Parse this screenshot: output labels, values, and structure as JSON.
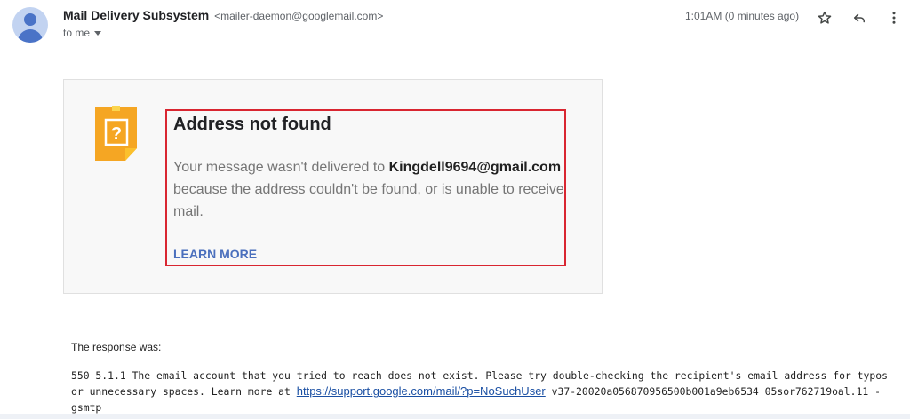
{
  "header": {
    "sender_name": "Mail Delivery Subsystem",
    "sender_email": "<mailer-daemon@googlemail.com>",
    "to_label": "to me",
    "timestamp": "1:01AM (0 minutes ago)",
    "icons": [
      "avatar",
      "star-icon",
      "reply-icon",
      "more-vert-icon",
      "chevron-down-icon"
    ]
  },
  "card": {
    "icon": "question-note-icon",
    "title": "Address not found",
    "body_prefix": "Your message wasn't delivered to ",
    "recipient": "Kingdell9694@gmail.com",
    "body_suffix": " because the address couldn't be found, or is unable to receive mail.",
    "learn_more": "LEARN MORE",
    "highlight_color": "#d92631",
    "link_color": "#4a6fbd"
  },
  "response": {
    "label": "The response was:",
    "text_prefix": "550 5.1.1 The email account that you tried to reach does not exist. Please try double-checking the recipient's email address for typos or unnecessary spaces. Learn more at ",
    "link": "https://support.google.com/mail/?p=NoSuchUser",
    "text_suffix": " v37-20020a056870956500b001a9eb6534 05sor762719oal.11 - gsmtp"
  }
}
